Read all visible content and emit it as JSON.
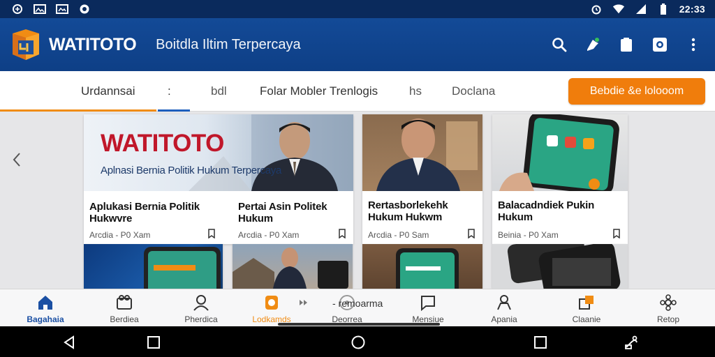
{
  "status_bar": {
    "time": "22:33",
    "left_icons": [
      "sync-icon",
      "image-icon",
      "gallery-icon",
      "circle-icon"
    ],
    "right_icons": [
      "alarm-icon",
      "wifi-icon",
      "signal-icon",
      "battery-icon"
    ]
  },
  "app_bar": {
    "brand": "WATITOTO",
    "tagline": "Boitdla Iltim Terpercaya",
    "actions": [
      "search-icon",
      "notification-icon",
      "clipboard-icon",
      "camera-icon",
      "more-icon"
    ]
  },
  "tabs": {
    "items": [
      "Urdannsai",
      ":",
      "bdl",
      "Folar Mobler Trenlogis",
      "hs",
      "Doclana"
    ],
    "cta_label": "Bebdie &e lolooom"
  },
  "cards": [
    {
      "hero_brand": "WATITOTO",
      "hero_sub": "Aplnasi Bernia Politik Hukum Terpercaya",
      "title": "Aplukasi Bernia Politik Hukwvre",
      "meta": "Arcdia - P0 Xam"
    },
    {
      "title": "Pertai Asin Politek Hukum",
      "meta": "Arcdia - P0 Xam"
    },
    {
      "title": "Rertasborlekehk Hukum Hukwm",
      "meta": "Arcdia - P0 Sam"
    },
    {
      "title": "Balacadndiek Pukin Hukum",
      "meta": "Beinia - P0 Xam"
    }
  ],
  "bottom_nav": {
    "items": [
      {
        "label": "Bagahaia",
        "icon": "home-icon"
      },
      {
        "label": "Berdiea",
        "icon": "news-icon"
      },
      {
        "label": "Pherdica",
        "icon": "profile-icon"
      },
      {
        "label": "Lodkamds",
        "icon": "bookmark-app-icon"
      },
      {
        "label": "Deorrea",
        "icon": "discover-icon"
      },
      {
        "label": "Mensiue",
        "icon": "chat-icon"
      },
      {
        "label": "Apania",
        "icon": "person-icon"
      },
      {
        "label": "Claanie",
        "icon": "share-icon"
      },
      {
        "label": "Retop",
        "icon": "settings-icon"
      }
    ],
    "middle_text": "- remoarma"
  },
  "colors": {
    "brand_blue": "#134a97",
    "accent_orange": "#f07d0c",
    "brand_red": "#c0172a"
  }
}
